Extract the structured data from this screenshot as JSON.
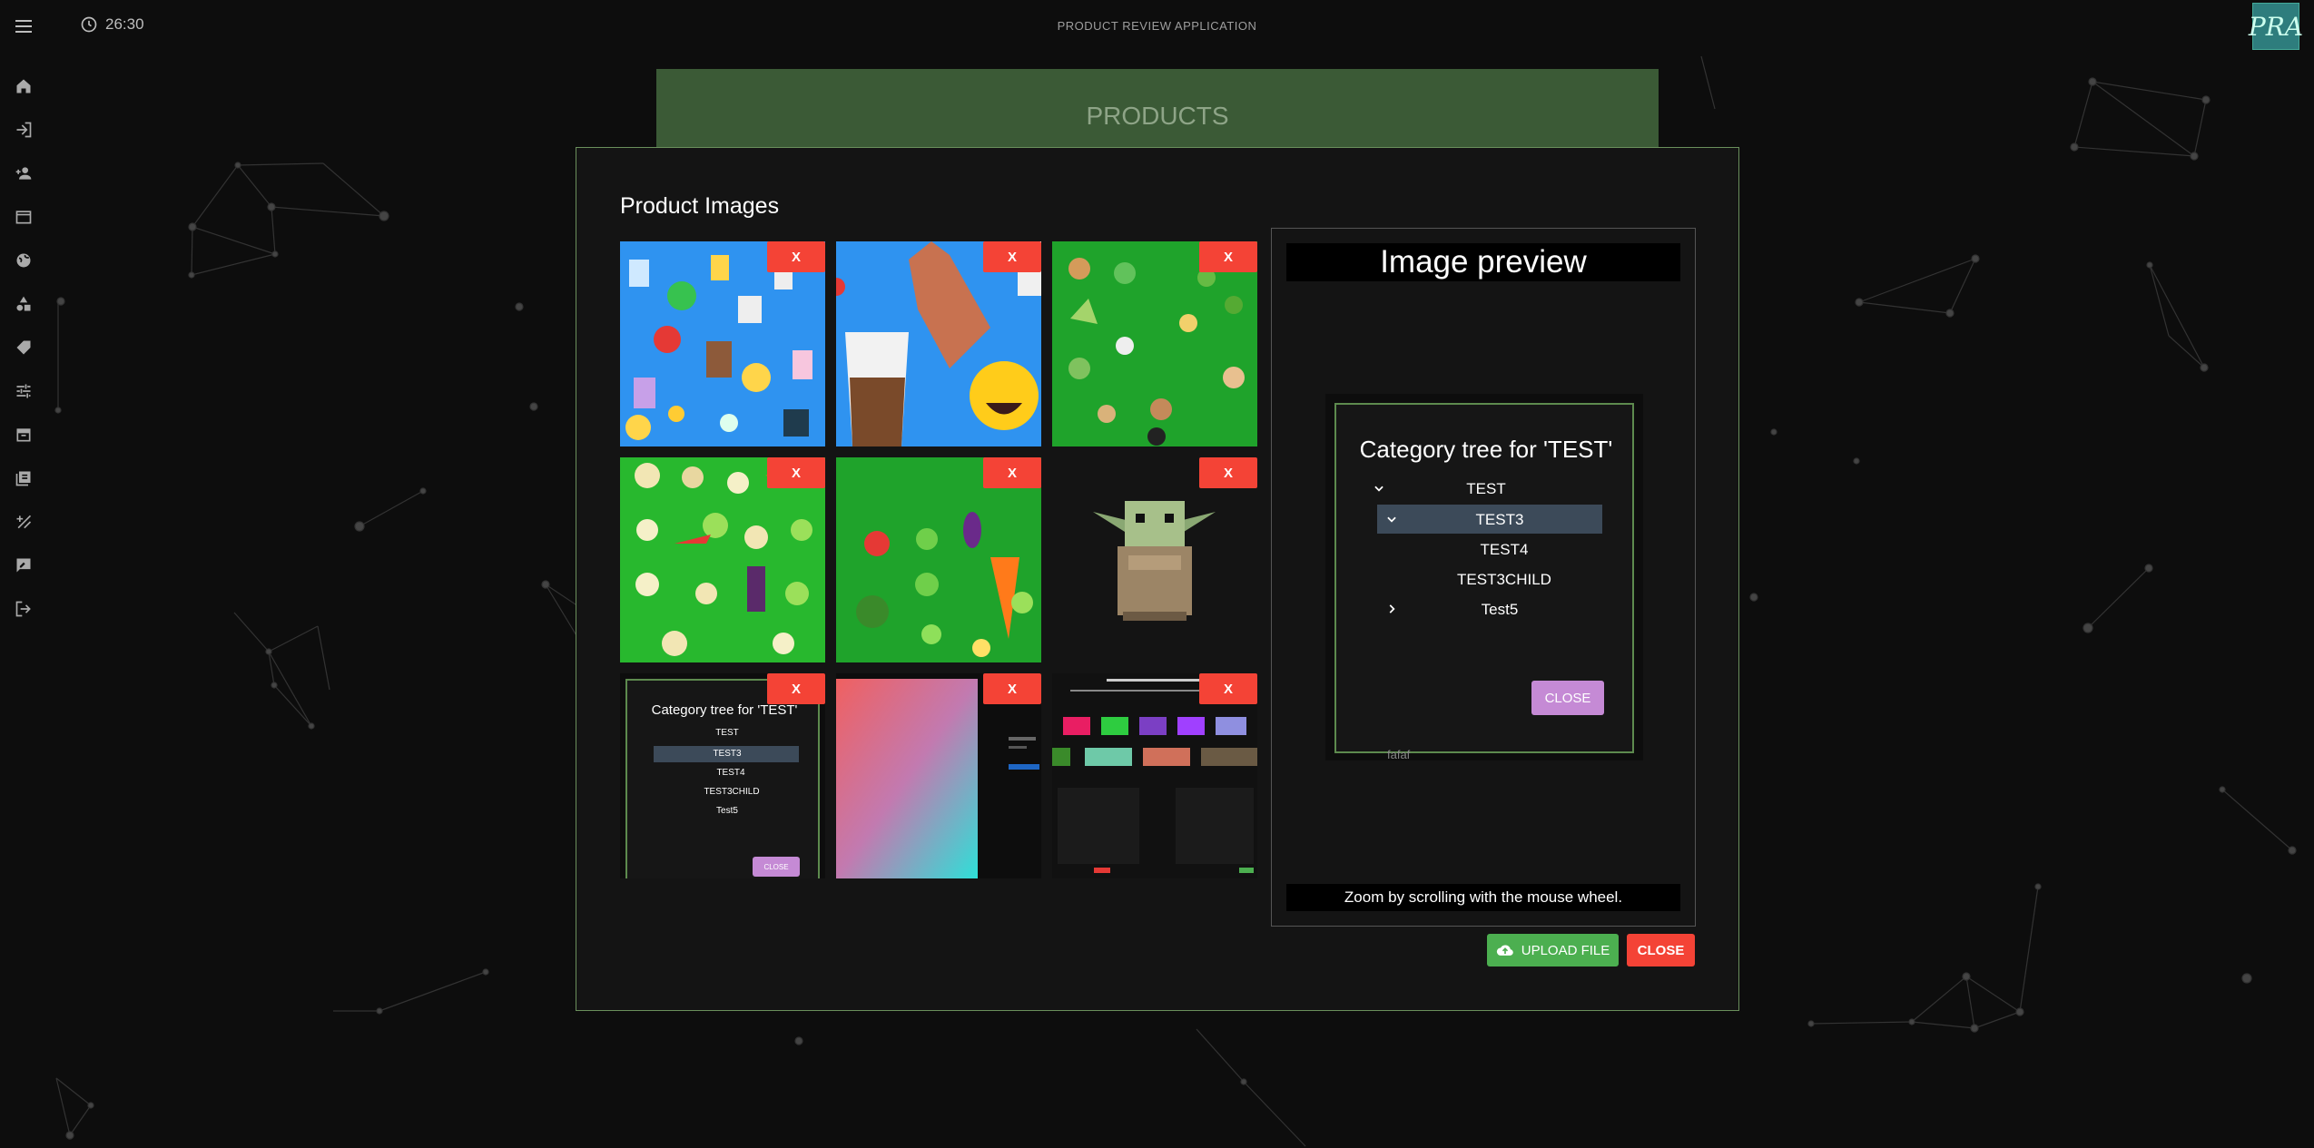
{
  "header": {
    "clock": "26:30",
    "app_title": "PRODUCT REVIEW APPLICATION",
    "logo_text": "PRA"
  },
  "sidebar": {
    "icons": [
      "home-icon",
      "login-icon",
      "add-user-icon",
      "store-icon",
      "globe-icon",
      "category-icon",
      "tag-icon",
      "tune-icon",
      "archive-icon",
      "reviews-icon",
      "percent-icon",
      "rate-review-icon",
      "logout-icon"
    ]
  },
  "page": {
    "banner": "PRODUCTS"
  },
  "dialog": {
    "title": "Product Images",
    "delete_label": "X",
    "images": [
      "drinks-pattern",
      "bottle-and-drink",
      "burger-faces-pattern",
      "vegetable-faces-pattern",
      "vegetable-pattern",
      "pixel-character",
      "category-tree-screenshot",
      "gradient-screenshot",
      "characteristics-screenshot"
    ],
    "thumb_tree": {
      "title": "Category tree for 'TEST'",
      "items": [
        "TEST",
        "TEST3",
        "TEST4",
        "TEST3CHILD",
        "Test5"
      ],
      "close": "CLOSE",
      "footer": "fafaf"
    },
    "preview": {
      "title": "Image preview",
      "hint": "Zoom by scrolling with the mouse wheel.",
      "tree": {
        "title": "Category tree for 'TEST'",
        "items": [
          "TEST",
          "TEST3",
          "TEST4",
          "TEST3CHILD",
          "Test5"
        ],
        "close": "CLOSE",
        "footer": "fafaf"
      }
    },
    "upload_label": "UPLOAD FILE",
    "close_label": "CLOSE"
  },
  "colors": {
    "accent_green": "#4caf50",
    "danger": "#f44336",
    "dialog_border": "#6a8f5c",
    "tree_close": "#c58ad5"
  }
}
